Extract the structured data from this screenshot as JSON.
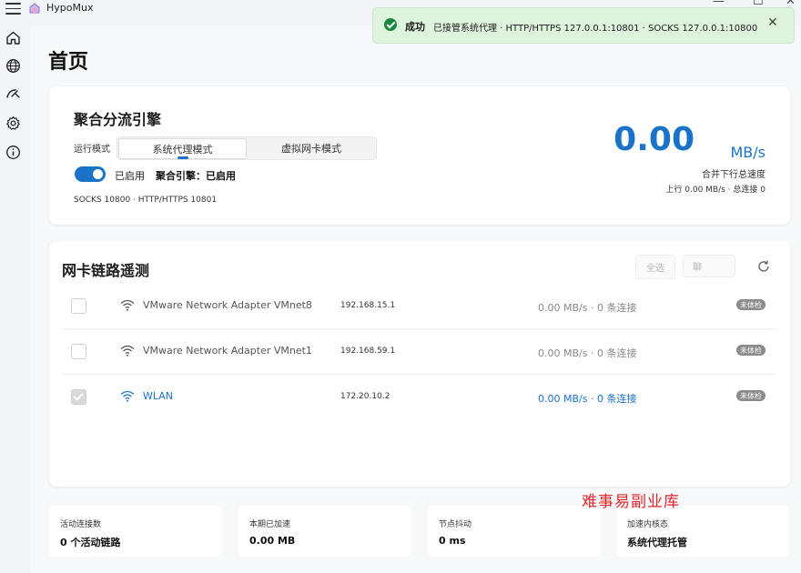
{
  "window": {
    "title": "HypoMux",
    "controls": {
      "minimize": "—",
      "maximize": "☐",
      "close": "✕"
    }
  },
  "sidebar": {
    "items": [
      {
        "name": "home",
        "icon": "home-icon"
      },
      {
        "name": "globe",
        "icon": "globe-icon"
      },
      {
        "name": "speed",
        "icon": "gauge-icon"
      },
      {
        "name": "settings",
        "icon": "gear-icon"
      },
      {
        "name": "about",
        "icon": "info-icon"
      }
    ]
  },
  "page": {
    "title": "首页"
  },
  "engine": {
    "title": "聚合分流引擎",
    "mode_label": "运行模式",
    "modes": [
      "系统代理模式",
      "虚拟网卡模式"
    ],
    "active_mode": 0,
    "enabled": true,
    "enabled_label": "已启用",
    "engine_status": "聚合引擎：已启用",
    "ports": "SOCKS 10800 · HTTP/HTTPS 10801",
    "speed_value": "0.00",
    "speed_unit": "MB/s",
    "speed_caption": "合并下行总速度",
    "speed_detail": "上行 0.00 MB/s · 总连接 0"
  },
  "adapters": {
    "title": "网卡链路遥测",
    "select_all_label": "全选",
    "second_button_label": "聊",
    "rows": [
      {
        "name": "VMware Network Adapter VMnet8",
        "ip": "192.168.15.1",
        "stats": "0.00 MB/s · 0 条连接",
        "badge": "未体检",
        "checked": false,
        "active": false
      },
      {
        "name": "VMware Network Adapter VMnet1",
        "ip": "192.168.59.1",
        "stats": "0.00 MB/s · 0 条连接",
        "badge": "未体检",
        "checked": false,
        "active": false
      },
      {
        "name": "WLAN",
        "ip": "172.20.10.2",
        "stats": "0.00 MB/s · 0 条连接",
        "badge": "未体检",
        "checked": true,
        "active": true
      }
    ]
  },
  "stats": [
    {
      "label": "活动连接数",
      "value": "0 个活动链路"
    },
    {
      "label": "本期已加速",
      "value": "0.00 MB"
    },
    {
      "label": "节点抖动",
      "value": "0 ms"
    },
    {
      "label": "加速内核态",
      "value": "系统代理托管"
    }
  ],
  "toast": {
    "title": "成功",
    "message": "已接管系统代理 · HTTP/HTTPS 127.0.0.1:10801 · SOCKS 127.0.0.1:10800",
    "close": "✕"
  },
  "watermark": "难事易副业库",
  "colors": {
    "accent": "#1a73c8",
    "success": "#17883a",
    "toast_bg": "#dff4dd",
    "watermark": "#e0272c"
  }
}
